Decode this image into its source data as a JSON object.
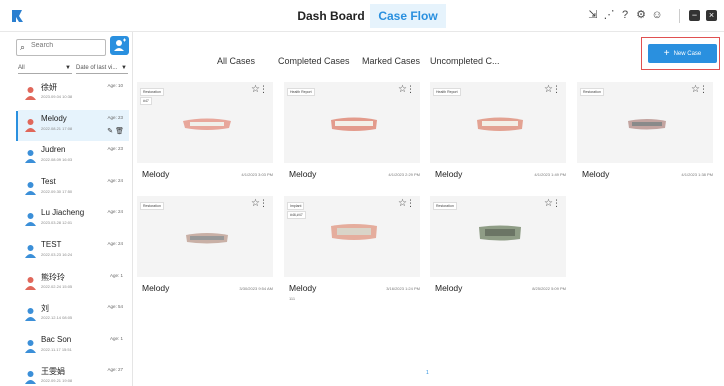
{
  "header": {
    "nav": [
      {
        "label": "Dash Board",
        "active": false
      },
      {
        "label": "Case Flow",
        "active": true
      }
    ],
    "icons": [
      "export-icon",
      "share-icon",
      "help-icon",
      "settings-icon",
      "user-icon"
    ],
    "window_controls": [
      "minimize-icon",
      "close-icon"
    ]
  },
  "sidebar": {
    "search_placeholder": "Search",
    "filter_all": "All",
    "filter_date": "Date of last vi...",
    "patients": [
      {
        "name": "徐妍",
        "date": "2023.09.04 10:38",
        "age": "Age: 10"
      },
      {
        "name": "Melody",
        "date": "2022.08.21 17:08",
        "age": "Age: 23",
        "selected": true
      },
      {
        "name": "Judren",
        "date": "2022.08.09 16:03",
        "age": "Age: 23"
      },
      {
        "name": "Test",
        "date": "2022.09.30 17:50",
        "age": "Age: 24"
      },
      {
        "name": "Lu Jiacheng",
        "date": "2023.03.28 12:01",
        "age": "Age: 24"
      },
      {
        "name": "TEST",
        "date": "2022.03.23 16:24",
        "age": "Age: 24"
      },
      {
        "name": "熊玲玲",
        "date": "2022.02.24 15:05",
        "age": "Age: 1"
      },
      {
        "name": "刘",
        "date": "2022.12.14 08:05",
        "age": "Age: 54"
      },
      {
        "name": "Bac Son",
        "date": "2022.11.17 15:51",
        "age": "Age: 1"
      },
      {
        "name": "王雯娟",
        "date": "2022.09.21 19:08",
        "age": "Age: 27"
      }
    ]
  },
  "main": {
    "tabs": [
      "All Cases",
      "Completed Cases",
      "Marked Cases",
      "Uncompleted C..."
    ],
    "new_case_label": "New Case",
    "cards": [
      {
        "tags": [
          "Restoration",
          "#47"
        ],
        "name": "Melody",
        "date": "4/1/2023 3:03 PM",
        "sub": ""
      },
      {
        "tags": [
          "Health Report"
        ],
        "name": "Melody",
        "date": "4/1/2023 2:29 PM",
        "sub": ""
      },
      {
        "tags": [
          "Health Report"
        ],
        "name": "Melody",
        "date": "4/1/2023 1:49 PM",
        "sub": ""
      },
      {
        "tags": [
          "Restoration"
        ],
        "name": "Melody",
        "date": "4/1/2023 1:38 PM",
        "sub": ""
      },
      {
        "tags": [
          "Restoration"
        ],
        "name": "Melody",
        "date": "3/30/2023 9:54 AM",
        "sub": ""
      },
      {
        "tags": [
          "Implant",
          "#46,#47"
        ],
        "name": "Melody",
        "date": "3/16/2023 1:24 PM",
        "sub": "111"
      },
      {
        "tags": [
          "Restoration"
        ],
        "name": "Melody",
        "date": "8/25/2022 5:09 PM",
        "sub": ""
      }
    ],
    "page": "1"
  },
  "colors": {
    "accent": "#2a90df",
    "highlight_border": "#e05050"
  }
}
